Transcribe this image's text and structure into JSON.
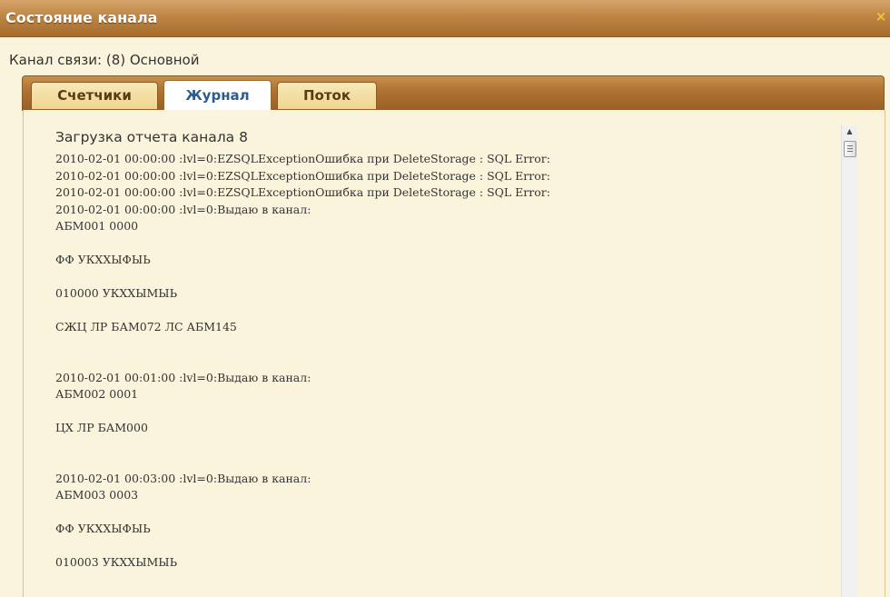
{
  "window": {
    "title": "Состояние канала",
    "close_glyph": "×"
  },
  "channel": {
    "label": "Канал связи: (8) Основной"
  },
  "tabs": [
    {
      "label": "Счетчики",
      "active": false
    },
    {
      "label": "Журнал",
      "active": true
    },
    {
      "label": "Поток",
      "active": false
    }
  ],
  "log": {
    "heading": "Загрузка отчета канала 8",
    "lines": [
      "2010-02-01 00:00:00 :lvl=0:EZSQLExceptionОшибка при DeleteStorage : SQL Error:",
      "2010-02-01 00:00:00 :lvl=0:EZSQLExceptionОшибка при DeleteStorage : SQL Error:",
      "2010-02-01 00:00:00 :lvl=0:EZSQLExceptionОшибка при DeleteStorage : SQL Error:",
      "2010-02-01 00:00:00 :lvl=0:Выдаю в канал:",
      "АБМ001 0000",
      "",
      "ФФ УКХХЫФЫЬ",
      "",
      "010000 УКХХЫМЫЬ",
      "",
      "СЖЦ ЛР БАМ072 ЛС АБМ145",
      "",
      "",
      "2010-02-01 00:01:00 :lvl=0:Выдаю в канал:",
      "АБМ002 0001",
      "",
      "ЦХ ЛР БАМ000",
      "",
      "",
      "2010-02-01 00:03:00 :lvl=0:Выдаю в канал:",
      "АБМ003 0003",
      "",
      "ФФ УКХХЫФЫЬ",
      "",
      "010003 УКХХЫМЫЬ",
      ""
    ]
  },
  "scrollbar": {
    "up_glyph": "▲"
  },
  "icons": {
    "close": "close-icon",
    "scroll_up": "arrow-up-icon"
  },
  "colors": {
    "titlebar": "#be8645",
    "tab_active_text": "#2e5b8a",
    "tab_text": "#5a3b12",
    "content_bg": "#fbf4dc"
  }
}
